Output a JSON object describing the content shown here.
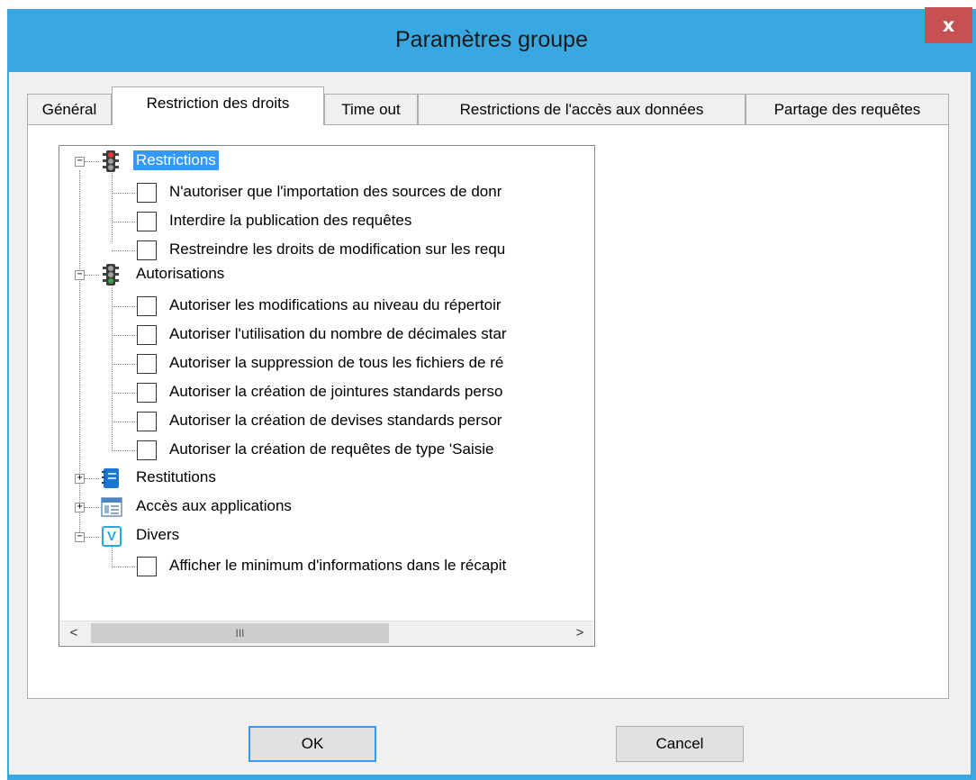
{
  "window": {
    "title": "Paramètres groupe",
    "close_label": "x"
  },
  "tabs": [
    {
      "label": "Général",
      "active": false
    },
    {
      "label": "Restriction des droits",
      "active": true
    },
    {
      "label": "Time out",
      "active": false
    },
    {
      "label": "Restrictions de l'accès aux données",
      "active": false
    },
    {
      "label": "Partage des requêtes",
      "active": false
    }
  ],
  "tree": {
    "restrictions": {
      "label": "Restrictions",
      "expander": "−",
      "items": [
        "N'autoriser que l'importation des sources de donr",
        "Interdire la publication des requêtes",
        "Restreindre les droits de modification sur les requ"
      ]
    },
    "autorisations": {
      "label": "Autorisations",
      "expander": "−",
      "items": [
        "Autoriser les modifications au niveau du répertoir",
        "Autoriser l'utilisation du nombre de décimales star",
        "Autoriser la suppression de tous les fichiers de ré",
        "Autoriser la création de jointures standards perso",
        "Autoriser la création de devises standards persor",
        "Autoriser la création de requêtes de type 'Saisie"
      ]
    },
    "restitutions": {
      "label": "Restitutions",
      "expander": "+"
    },
    "acces": {
      "label": "Accès aux applications",
      "expander": "+"
    },
    "divers": {
      "label": "Divers",
      "expander": "−",
      "icon_letter": "V",
      "items": [
        "Afficher le minimum d'informations dans le récapit"
      ]
    }
  },
  "scrollbar": {
    "left_arrow": "<",
    "right_arrow": ">",
    "thumb_grip": "III"
  },
  "buttons": {
    "ok": "OK",
    "cancel": "Cancel"
  },
  "colors": {
    "window_frame": "#39a8e0",
    "close_button": "#c75050",
    "selection": "#3399ff"
  }
}
